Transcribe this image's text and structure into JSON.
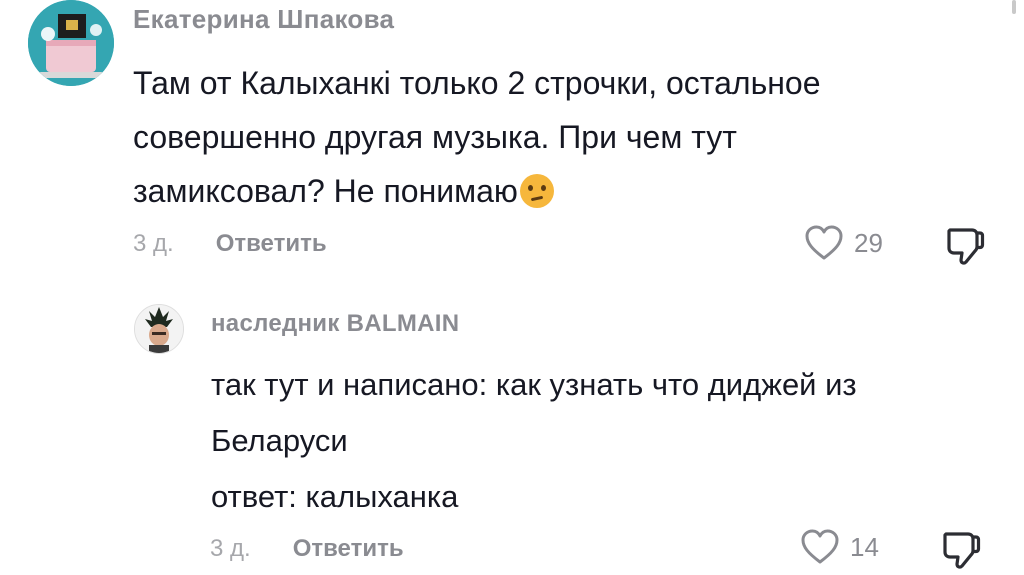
{
  "comments": [
    {
      "username": "Екатерина Шпакова",
      "text": "Там от Калыханкі только 2 строчки, остальное\nсовершенно другая музыка. При чем тут\nзамиксовал? Не понимаю",
      "emoji": "thinking-face-emoji",
      "date": "3 д.",
      "reply_label": "Ответить",
      "likes": "29"
    },
    {
      "username": "наследник BALMAIN",
      "text": "так тут и написано: как узнать что диджей из\nБеларуси\nответ: калыханка",
      "date": "3 д.",
      "reply_label": "Ответить",
      "likes": "14"
    }
  ]
}
